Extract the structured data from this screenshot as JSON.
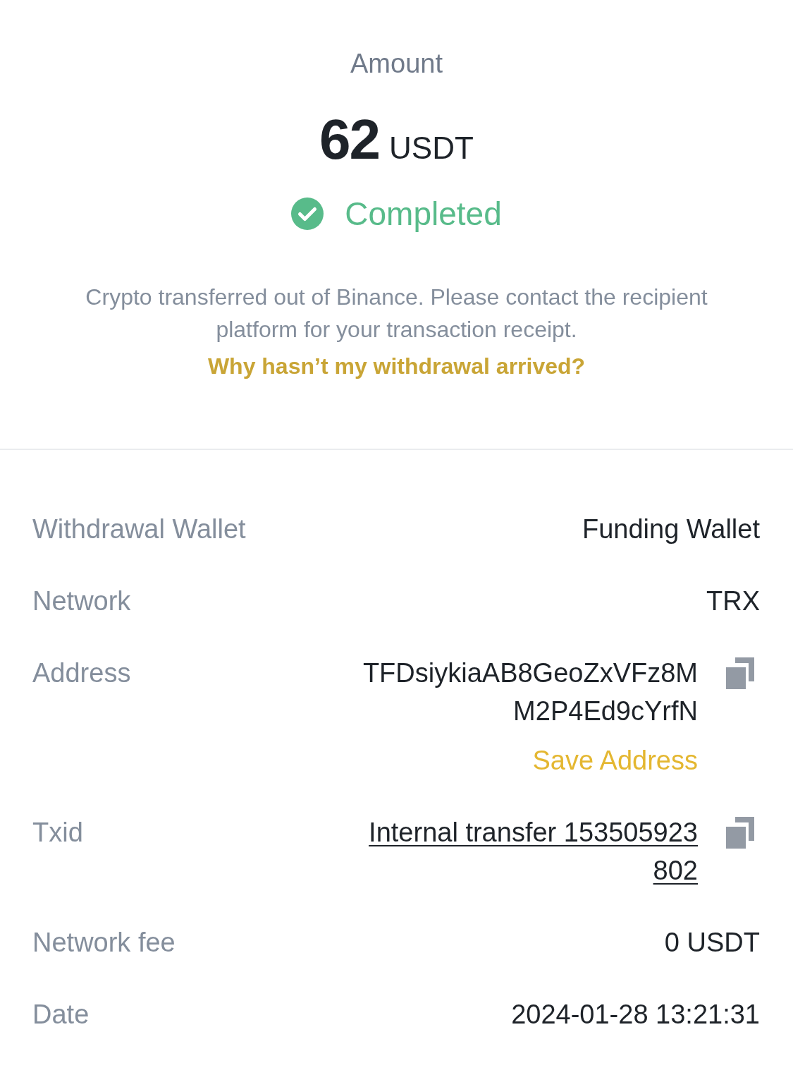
{
  "summary": {
    "label": "Amount",
    "amount": "62",
    "currency": "USDT",
    "status": {
      "kind": "completed",
      "label": "Completed"
    },
    "note": "Crypto transferred out of Binance. Please contact the recipient platform for your transaction receipt.",
    "help_link": "Why hasn’t my withdrawal arrived?"
  },
  "details": [
    {
      "kind": "plain",
      "label": "Withdrawal Wallet",
      "value": "Funding Wallet",
      "copyable": false
    },
    {
      "kind": "plain",
      "label": "Network",
      "value": "TRX",
      "copyable": false
    },
    {
      "kind": "address",
      "label": "Address",
      "value": "TFDsiykiaAB8GeoZxVFz8MM2P4Ed9cYrfN",
      "copyable": true,
      "action": "Save Address"
    },
    {
      "kind": "link",
      "label": "Txid",
      "value": "Internal transfer 153505923802",
      "copyable": true
    },
    {
      "kind": "plain",
      "label": "Network fee",
      "value": "0 USDT",
      "copyable": false
    },
    {
      "kind": "plain",
      "label": "Date",
      "value": "2024-01-28 13:21:31",
      "copyable": false
    }
  ]
}
